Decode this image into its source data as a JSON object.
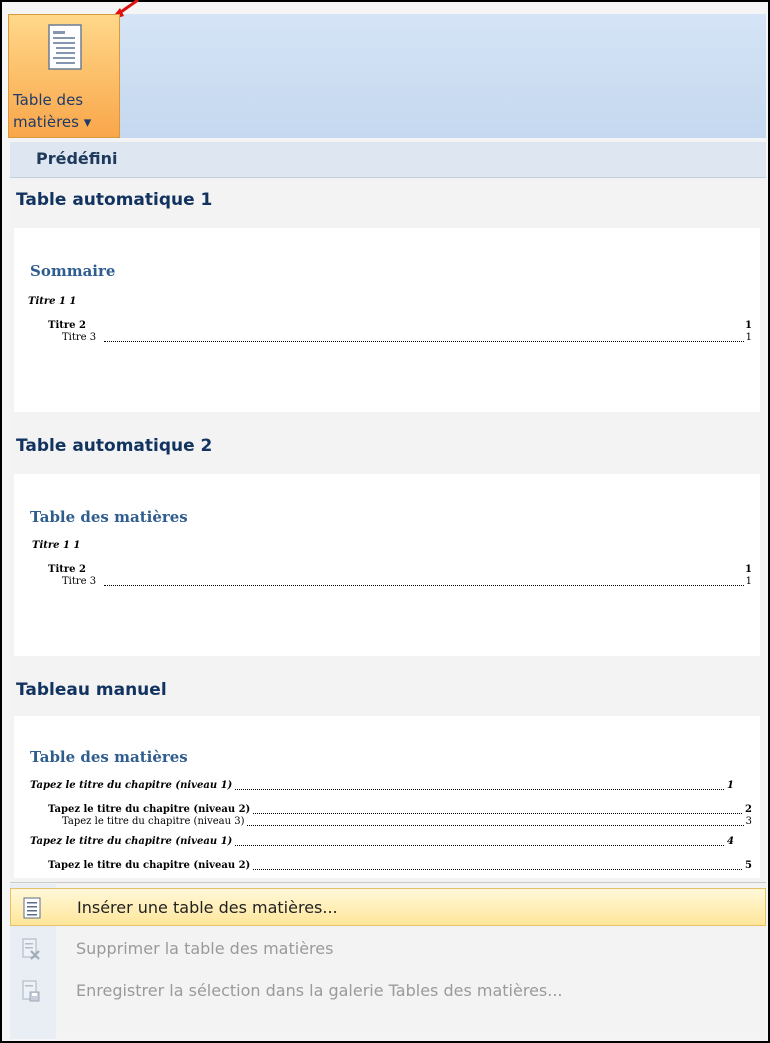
{
  "ribbon": {
    "button_line1": "Table des",
    "button_line2": "matières ▾"
  },
  "menu": {
    "header": "Prédéfini",
    "sections": [
      {
        "title": "Table automatique 1",
        "preview_heading": "Sommaire",
        "lines": [
          "Titre 1 1",
          "Titre 2",
          "1",
          "Titre 3",
          "1"
        ]
      },
      {
        "title": "Table automatique 2",
        "preview_heading": "Table des matières",
        "lines": [
          "Titre 1 1",
          "Titre 2",
          "1",
          "Titre 3",
          "1"
        ]
      },
      {
        "title": "Tableau manuel",
        "preview_heading": "Table des matières",
        "lines": [
          "Tapez le titre du chapitre (niveau 1)",
          "1",
          "Tapez le titre du chapitre (niveau 2)",
          "2",
          "Tapez le titre du chapitre (niveau 3)",
          "3",
          "Tapez le titre du chapitre (niveau 1)",
          "4",
          "Tapez le titre du chapitre (niveau 2)",
          "5"
        ]
      }
    ],
    "items": [
      {
        "label": "Insérer une table des matières...",
        "icon": "document-icon",
        "enabled": true
      },
      {
        "label": "Supprimer la table des matières",
        "icon": "delete-document-icon",
        "enabled": false
      },
      {
        "label": "Enregistrer la sélection dans la galerie Tables des matières...",
        "icon": "save-to-gallery-icon",
        "enabled": false
      }
    ]
  },
  "colors": {
    "button_active": "#f9a64a",
    "heading_blue": "#2f5d8f",
    "section_title": "#12335f",
    "highlight": "#ffe69a"
  }
}
